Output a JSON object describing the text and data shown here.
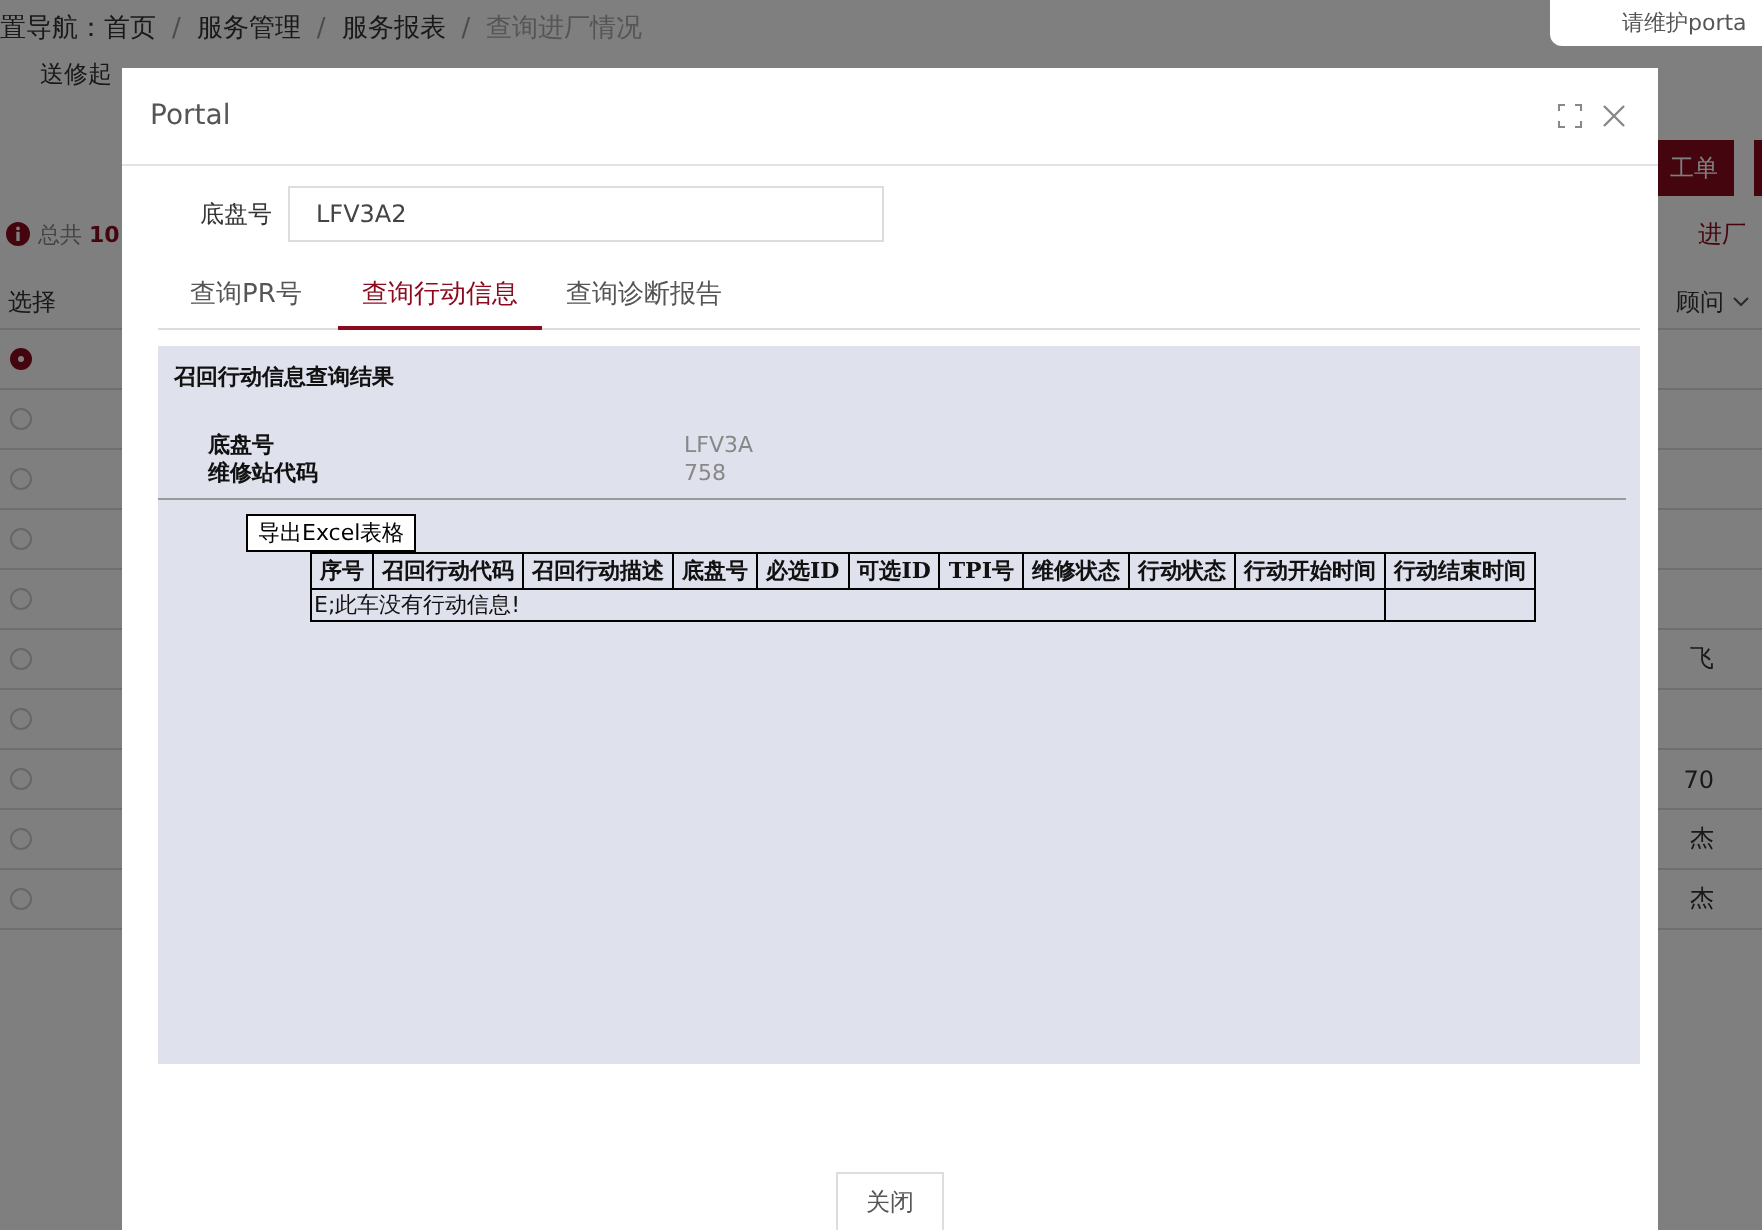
{
  "background_page": {
    "notice": "请维护porta",
    "breadcrumb": [
      {
        "label": "置导航：",
        "kind": "prefix"
      },
      {
        "label": "首页",
        "kind": "link"
      },
      {
        "label": "/",
        "kind": "separator"
      },
      {
        "label": "服务管理",
        "kind": "link"
      },
      {
        "label": "/",
        "kind": "separator"
      },
      {
        "label": "服务报表",
        "kind": "link"
      },
      {
        "label": "/",
        "kind": "separator"
      },
      {
        "label": "查询进厂情况",
        "kind": "current"
      }
    ],
    "filter_label": "送修起",
    "action_buttons": [
      {
        "kind": "text",
        "label": "工单"
      },
      {
        "kind": "blank"
      }
    ],
    "summary": {
      "prefix": "总共",
      "count": "10"
    },
    "side_link": "进厂",
    "table": {
      "columns": [
        "选择",
        "顾问"
      ],
      "rows": [
        {
          "selected": true
        },
        {
          "selected": false
        },
        {
          "selected": false
        },
        {
          "selected": false
        },
        {
          "selected": false
        },
        {
          "selected": false,
          "last": "飞"
        },
        {
          "selected": false
        },
        {
          "selected": false,
          "last": "70"
        },
        {
          "selected": false,
          "last": "杰"
        },
        {
          "selected": false,
          "last": "杰"
        }
      ]
    }
  },
  "modal": {
    "title": "Portal",
    "field": {
      "label": "底盘号",
      "value": "LFV3A2"
    },
    "tabs": [
      {
        "label": "查询PR号",
        "selected": false
      },
      {
        "label": "查询行动信息",
        "selected": true
      },
      {
        "label": "查询诊断报告",
        "selected": false
      }
    ],
    "result": {
      "title": "召回行动信息查询结果",
      "info": [
        {
          "label": "底盘号",
          "value": "LFV3A"
        },
        {
          "label": "维修站代码",
          "value": "758"
        }
      ],
      "export_button": "导出Excel表格",
      "table": {
        "columns": [
          "序号",
          "召回行动代码",
          "召回行动描述",
          "底盘号",
          "必选ID",
          "可选ID",
          "TPI号",
          "维修状态",
          "行动状态",
          "行动开始时间",
          "行动结束时间"
        ],
        "message": "E;此车没有行动信息!"
      }
    },
    "close_button": "关闭"
  }
}
